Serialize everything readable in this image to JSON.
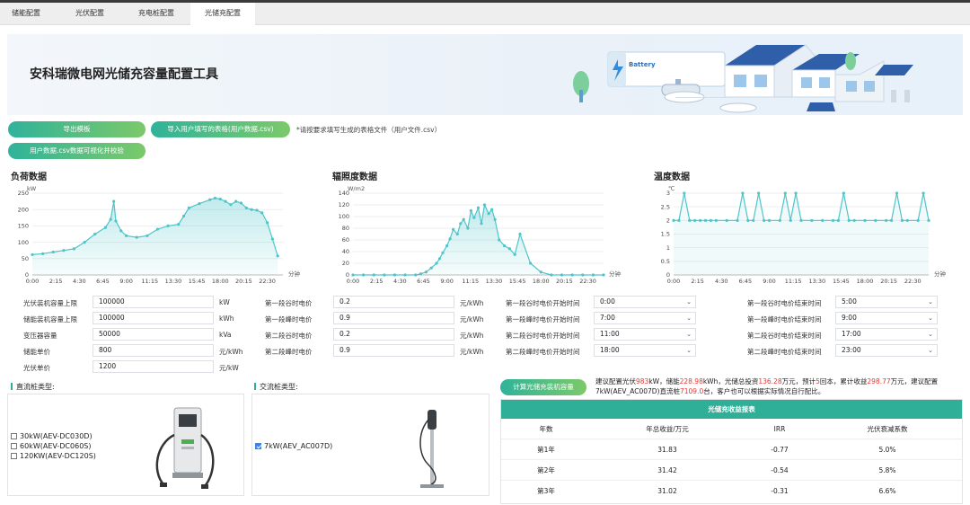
{
  "tabs": [
    {
      "label": "储能配置",
      "active": false
    },
    {
      "label": "光伏配置",
      "active": false
    },
    {
      "label": "充电桩配置",
      "active": false
    },
    {
      "label": "光储充配置",
      "active": true
    }
  ],
  "banner": {
    "title": "安科瑞微电网光储充容量配置工具",
    "battery_sign": "Battery"
  },
  "buttons": {
    "export_template": "导出模板",
    "import_table": "导入用户填写的表格(用户数据.csv)",
    "visualize": "用户数据.csv数据可视化并校验",
    "import_note": "*请按要求填写生成的表格文件（用户文件.csv）",
    "calculate": "计算光储充装机容量"
  },
  "charts": {
    "load": {
      "title": "负荷数据",
      "unit": "kW"
    },
    "irradiance": {
      "title": "辐照度数据",
      "unit": "W/m2"
    },
    "temperature": {
      "title": "温度数据",
      "unit": "℃"
    },
    "x_unit": "分钟"
  },
  "chart_data": [
    {
      "type": "area",
      "ylabel": "kW",
      "xlabel": "分钟",
      "ylim": [
        0,
        250
      ],
      "yticks": [
        0,
        50,
        100,
        150,
        200,
        250
      ],
      "xticks": [
        "0:00",
        "2:15",
        "4:30",
        "6:45",
        "9:00",
        "11:15",
        "13:30",
        "15:45",
        "18:00",
        "20:15",
        "22:30"
      ],
      "x_hours": [
        0,
        1,
        2,
        3,
        4,
        5,
        6,
        7,
        7.5,
        7.8,
        8,
        8.5,
        9,
        10,
        11,
        12,
        13,
        14,
        14.5,
        15,
        16,
        17,
        17.5,
        18,
        18.5,
        19,
        19.5,
        20,
        20.5,
        21,
        21.5,
        22,
        22.5,
        23,
        23.5
      ],
      "values": [
        62,
        65,
        70,
        75,
        80,
        100,
        125,
        145,
        170,
        225,
        165,
        135,
        120,
        115,
        120,
        140,
        150,
        155,
        180,
        205,
        218,
        230,
        235,
        232,
        225,
        215,
        225,
        220,
        205,
        200,
        198,
        190,
        160,
        110,
        58
      ]
    },
    {
      "type": "area",
      "ylabel": "W/m2",
      "xlabel": "分钟",
      "ylim": [
        0,
        140
      ],
      "yticks": [
        0,
        20,
        40,
        60,
        80,
        100,
        120,
        140
      ],
      "xticks": [
        "0:00",
        "2:15",
        "4:30",
        "6:45",
        "9:00",
        "11:15",
        "13:30",
        "15:45",
        "18:00",
        "20:15",
        "22:30"
      ],
      "x_hours": [
        0,
        1,
        2,
        3,
        4,
        5,
        6,
        6.5,
        7,
        7.5,
        8,
        8.3,
        8.6,
        9,
        9.3,
        9.6,
        10,
        10.3,
        10.6,
        11,
        11.3,
        11.6,
        12,
        12.3,
        12.6,
        13,
        13.3,
        13.6,
        14,
        14.5,
        15,
        15.5,
        16,
        17,
        18,
        19,
        20,
        21,
        22,
        23,
        24
      ],
      "values": [
        0,
        0,
        0,
        0,
        0,
        0,
        0,
        2,
        5,
        12,
        20,
        28,
        38,
        50,
        62,
        78,
        70,
        88,
        95,
        80,
        110,
        98,
        115,
        88,
        120,
        105,
        112,
        95,
        60,
        50,
        45,
        35,
        70,
        20,
        5,
        0,
        0,
        0,
        0,
        0,
        0
      ]
    },
    {
      "type": "line",
      "ylabel": "℃",
      "xlabel": "分钟",
      "ylim": [
        0,
        3
      ],
      "yticks": [
        0,
        0.5,
        1,
        1.5,
        2,
        2.5,
        3
      ],
      "xticks": [
        "0:00",
        "2:15",
        "4:30",
        "6:45",
        "9:00",
        "11:15",
        "13:30",
        "15:45",
        "18:00",
        "20:15",
        "22:30"
      ],
      "x_hours": [
        0,
        0.5,
        1,
        1.5,
        2,
        2.5,
        3,
        3.5,
        4,
        5,
        6,
        6.5,
        7,
        7.5,
        8,
        8.5,
        9,
        10,
        10.5,
        11,
        11.5,
        12,
        13,
        14,
        15,
        15.5,
        16,
        16.5,
        17,
        18,
        19,
        20,
        20.5,
        21,
        21.5,
        22,
        23,
        23.5,
        24
      ],
      "values": [
        2,
        2,
        3,
        2,
        2,
        2,
        2,
        2,
        2,
        2,
        2,
        3,
        2,
        2,
        3,
        2,
        2,
        2,
        3,
        2,
        3,
        2,
        2,
        2,
        2,
        2,
        3,
        2,
        2,
        2,
        2,
        2,
        2,
        3,
        2,
        2,
        2,
        3,
        2
      ]
    }
  ],
  "params": {
    "pv_capacity_limit": {
      "label": "光伏装机容量上限",
      "value": "100000",
      "unit": "kW"
    },
    "storage_capacity_limit": {
      "label": "储能装机容量上限",
      "value": "100000",
      "unit": "kWh"
    },
    "transformer_capacity": {
      "label": "变压器容量",
      "value": "50000",
      "unit": "kVa"
    },
    "storage_price": {
      "label": "储能单价",
      "value": "800",
      "unit": "元/kWh"
    },
    "pv_price": {
      "label": "光伏单价",
      "value": "1200",
      "unit": "元/kW"
    },
    "valley1_price": {
      "label": "第一段谷时电价",
      "value": "0.2",
      "unit": "元/kWh"
    },
    "peak1_price": {
      "label": "第一段峰时电价",
      "value": "0.9",
      "unit": "元/kWh"
    },
    "valley2_price": {
      "label": "第二段谷时电价",
      "value": "0.2",
      "unit": "元/kWh"
    },
    "peak2_price": {
      "label": "第二段峰时电价",
      "value": "0.9",
      "unit": "元/kWh"
    },
    "valley1_start": {
      "label": "第一段谷时电价开始时间",
      "value": "0:00"
    },
    "peak1_start": {
      "label": "第一段峰时电价开始时间",
      "value": "7:00"
    },
    "valley2_start": {
      "label": "第二段谷时电价开始时间",
      "value": "11:00"
    },
    "peak2_start": {
      "label": "第二段峰时电价开始时间",
      "value": "18:00"
    },
    "valley1_end": {
      "label": "第一段谷时电价结束时间",
      "value": "5:00"
    },
    "peak1_end": {
      "label": "第一段峰时电价结束时间",
      "value": "9:00"
    },
    "valley2_end": {
      "label": "第二段谷时电价结束时间",
      "value": "17:00"
    },
    "peak2_end": {
      "label": "第二段峰时电价结束时间",
      "value": "23:00"
    }
  },
  "dc_panel": {
    "title": "直流桩类型:",
    "options": [
      {
        "label": "30kW(AEV-DC030D)",
        "checked": false
      },
      {
        "label": "60kW(AEV-DC060S)",
        "checked": false
      },
      {
        "label": "120KW(AEV-DC120S)",
        "checked": false
      }
    ]
  },
  "ac_panel": {
    "title": "交流桩类型:",
    "options": [
      {
        "label": "7kW(AEV_AC007D)",
        "checked": true
      }
    ]
  },
  "advice": {
    "p1": "建议配置光伏",
    "pv": "983",
    "p2": "kW，储能",
    "storage": "228.98",
    "p3": "kWh，光储总投资",
    "investment": "136.28",
    "p4": "万元，预计",
    "payback": "5",
    "p5": "回本，累计收益",
    "income": "298.77",
    "p6": "万元，建议配置",
    "p7": "7kW(AEV_AC007D)直流桩",
    "chargers": "7109.0",
    "p8": "台，客户也可以根据实际情况自行配比。"
  },
  "revenue_table": {
    "title": "光储充收益报表",
    "headers": [
      "年数",
      "年总收益/万元",
      "IRR",
      "光伏衰减系数"
    ],
    "rows": [
      [
        "第1年",
        "31.83",
        "-0.77",
        "5.0%"
      ],
      [
        "第2年",
        "31.42",
        "-0.54",
        "5.8%"
      ],
      [
        "第3年",
        "31.02",
        "-0.31",
        "6.6%"
      ]
    ]
  },
  "colors": {
    "accent": "#2fae98",
    "line": "#4fc5c9",
    "highlight": "#e53935"
  }
}
